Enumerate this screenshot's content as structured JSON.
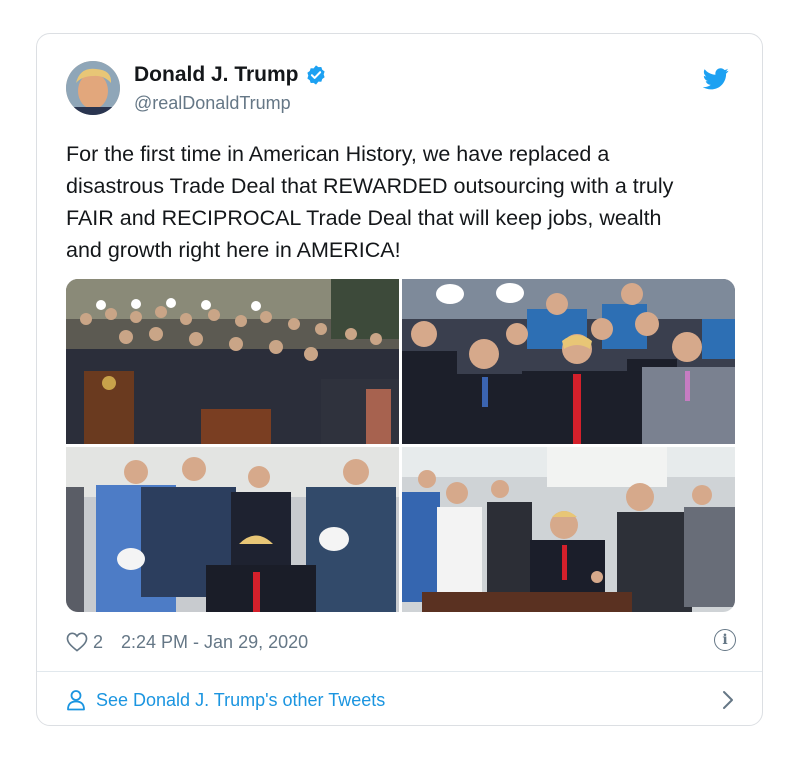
{
  "author": {
    "name": "Donald J. Trump",
    "handle": "@realDonaldTrump",
    "verified": true,
    "avatar_icon": "avatar-photo"
  },
  "tweet": {
    "text": "For the first time in American History, we have replaced a\ndisastrous Trade Deal that REWARDED outsourcing with a truly\nFAIR and RECIPROCAL Trade Deal that will keep jobs, wealth\nand growth right here in AMERICA!"
  },
  "media": [
    {
      "icon": "photo-signing-ceremony-crowd"
    },
    {
      "icon": "photo-officials-in-suits"
    },
    {
      "icon": "photo-workers-in-hardhats"
    },
    {
      "icon": "photo-handshake-at-desk"
    }
  ],
  "meta": {
    "likes": "2",
    "timestamp": "2:24 PM - Jan 29, 2020",
    "info_glyph": "i"
  },
  "footer": {
    "link_label": "See Donald J. Trump's other Tweets"
  },
  "colors": {
    "twitter_blue": "#1da1f2",
    "link_blue": "#1b95e0",
    "text": "#14171a",
    "muted": "#657786",
    "border": "#dcdfe3"
  }
}
